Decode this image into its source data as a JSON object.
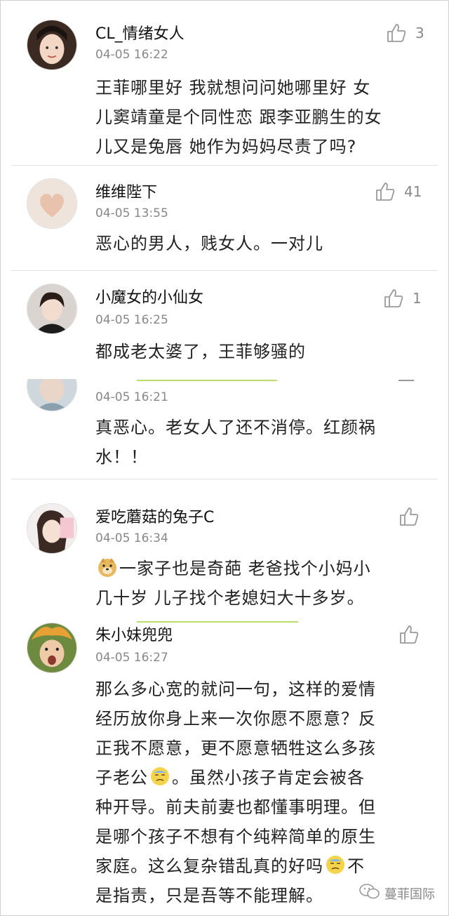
{
  "comments": [
    {
      "username": "CL_情绪女人",
      "time": "04-05 16:22",
      "likes": "3",
      "lines": [
        "王菲哪里好 我就想问问她哪里好 女",
        "儿窦靖童是个同性恋 跟李亚鹏生的女",
        "儿又是兔唇 她作为妈妈尽责了吗?"
      ]
    },
    {
      "username": "维维陛下",
      "time": "04-05 13:55",
      "likes": "41",
      "lines": [
        "恶心的男人，贱女人。一对儿"
      ]
    },
    {
      "username": "小魔女的小仙女",
      "time": "04-05 16:25",
      "likes": "1",
      "lines": [
        "都成老太婆了，王菲够骚的"
      ]
    },
    {
      "username": "",
      "time": "04-05 16:21",
      "likes": "",
      "lines": [
        "真恶心。老女人了还不消停。红颜祸",
        "水！！"
      ]
    },
    {
      "username": "爱吃蘑菇的兔子C",
      "time": "04-05 16:34",
      "likes": "",
      "lines": [
        "一家子也是奇葩 老爸找个小妈小",
        "几十岁 儿子找个老媳妇大十多岁。"
      ]
    },
    {
      "username": "朱小妹兜兜",
      "time": "04-05 16:27",
      "likes": "",
      "lines": [
        "那么多心宽的就问一句，这样的爱情",
        "经历放你身上来一次你愿不愿意？反",
        "正我不愿意，更不愿意牺牲这么多孩",
        "子老公",
        "。虽然小孩子肯定会被各",
        "种开导。前夫前妻也都懂事明理。但",
        "是哪个孩子不想有个纯粹简单的原生",
        "家庭。这么复杂错乱真的好吗",
        "不",
        "是指责，只是吾等不能理解。"
      ]
    }
  ],
  "watermark": "蔓菲国际",
  "icons": {
    "like": "thumbs-up-icon",
    "emoji_doge": "doge-emoji-icon",
    "emoji_sweat": "sweat-emoji-icon",
    "wechat": "wechat-icon"
  },
  "colors": {
    "divider": "#e2e2e2",
    "green_rule": "#b9e06a",
    "meta": "#888888"
  }
}
